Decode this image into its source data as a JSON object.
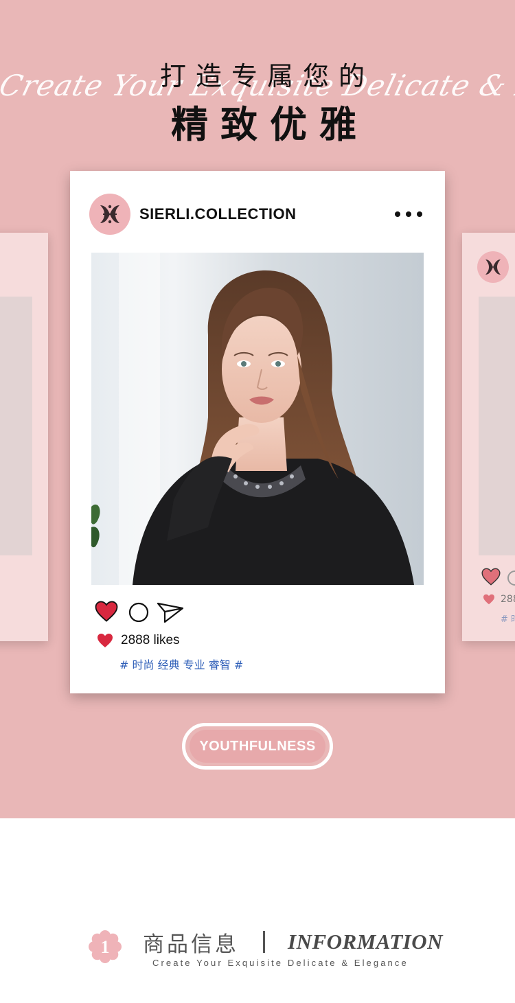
{
  "header": {
    "title_line1": "打造专属您的",
    "title_line2": "精致优雅",
    "script_text": "Create Your Exquisite Delicate & Elegance"
  },
  "post": {
    "username": "SIERLI.COLLECTION",
    "avatar_icon": "brand-logo-icon",
    "likes_text": "2888 likes",
    "tags": "# 时尚 经典 专业 睿智 #",
    "actions": [
      "heart-icon",
      "comment-icon",
      "share-icon"
    ]
  },
  "side_cards": {
    "right_likes": "288",
    "right_tags": "# 时"
  },
  "badge": {
    "label": "YOUTHFULNESS"
  },
  "info": {
    "number": "1",
    "title_cn": "商品信息",
    "title_en": "INFORMATION",
    "subtitle": "Create Your Exquisite Delicate & Elegance"
  },
  "colors": {
    "banner_pink": "#e9b7b7",
    "card_pink": "#f6dcdc",
    "heart_red": "#d8283f",
    "tag_blue": "#2f5fb8",
    "badge_pink": "#e7a9ab",
    "text_dark": "#111111"
  }
}
